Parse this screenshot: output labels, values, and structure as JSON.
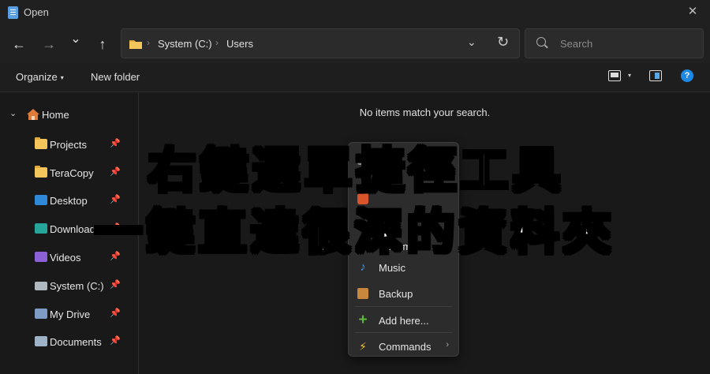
{
  "window": {
    "title": "Open",
    "close_glyph": "✕"
  },
  "nav": {
    "back_glyph": "←",
    "forward_glyph": "→",
    "recent_glyph": "⌄",
    "up_glyph": "↑",
    "path": [
      "System (C:)",
      "Users"
    ],
    "path_sep": "›",
    "dropdown_glyph": "⌄",
    "refresh_glyph": "↻",
    "search_placeholder": "Search"
  },
  "toolbar": {
    "organize": "Organize",
    "new_folder": "New folder",
    "help_glyph": "?"
  },
  "sidebar": {
    "home": "Home",
    "expand_glyph": "⌄",
    "pin_glyph": "📌",
    "items": [
      {
        "label": "Projects",
        "icon": "folder-icon"
      },
      {
        "label": "TeraCopy",
        "icon": "folder-icon"
      },
      {
        "label": "Desktop",
        "icon": "desktop-icon"
      },
      {
        "label": "Downloads",
        "icon": "downloads-icon"
      },
      {
        "label": "Videos",
        "icon": "videos-icon"
      },
      {
        "label": "System (C:)",
        "icon": "drive-icon"
      },
      {
        "label": "My Drive",
        "icon": "cloud-drive-icon"
      },
      {
        "label": "Documents",
        "icon": "documents-icon"
      }
    ]
  },
  "content": {
    "empty_message": "No items match your search."
  },
  "context_menu": {
    "items": [
      {
        "label": "Documents",
        "icon": "pie-icon"
      },
      {
        "label": "Music",
        "icon": "music-icon"
      },
      {
        "label": "Backup",
        "icon": "box-icon"
      },
      {
        "label": "Add here...",
        "icon": "plus-icon"
      },
      {
        "label": "Commands",
        "icon": "bolt-icon",
        "submenu_glyph": "›"
      }
    ]
  },
  "overlay": {
    "line1": "右鍵選單捷徑工具",
    "line2": "一鍵直達很深的資料夾"
  },
  "colors": {
    "accent": "#1e88e5",
    "folder": "#f4c55b",
    "background": "#191919"
  }
}
